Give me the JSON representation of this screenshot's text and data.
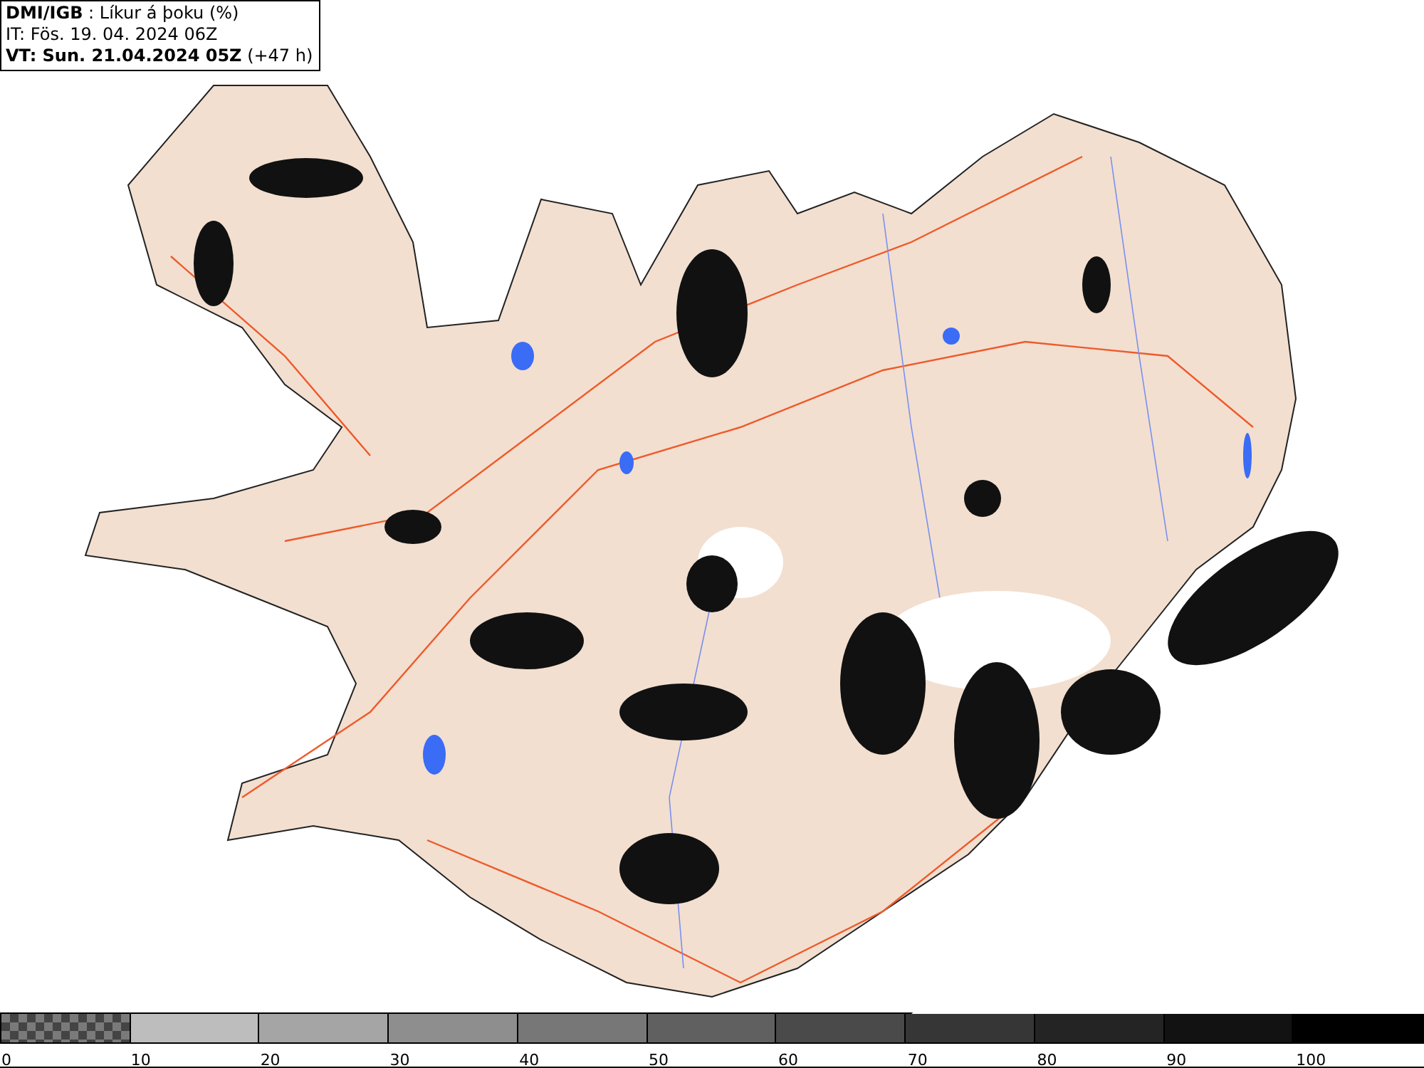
{
  "header": {
    "lines": [
      "**DMI/IGB** : Líkur á þoku (%)",
      "IT: Fös. 19. 04. 2024 06Z",
      "**VT: Sun. 21.04.2024 05Z** (+47 h)"
    ]
  },
  "legend": {
    "swatches": [
      {
        "kind": "checker",
        "color": "#7a7a7a"
      },
      {
        "kind": "solid",
        "color": "#bdbdbd"
      },
      {
        "kind": "solid",
        "color": "#a5a5a5"
      },
      {
        "kind": "solid",
        "color": "#8e8e8e"
      },
      {
        "kind": "solid",
        "color": "#777777"
      },
      {
        "kind": "solid",
        "color": "#606060"
      },
      {
        "kind": "solid",
        "color": "#4a4a4a"
      },
      {
        "kind": "solid",
        "color": "#363636"
      },
      {
        "kind": "solid",
        "color": "#242424"
      },
      {
        "kind": "solid",
        "color": "#121212"
      },
      {
        "kind": "solid",
        "color": "#000000"
      }
    ],
    "labels": [
      "0",
      "10",
      "20",
      "30",
      "40",
      "50",
      "60",
      "70",
      "80",
      "90",
      "100"
    ]
  }
}
